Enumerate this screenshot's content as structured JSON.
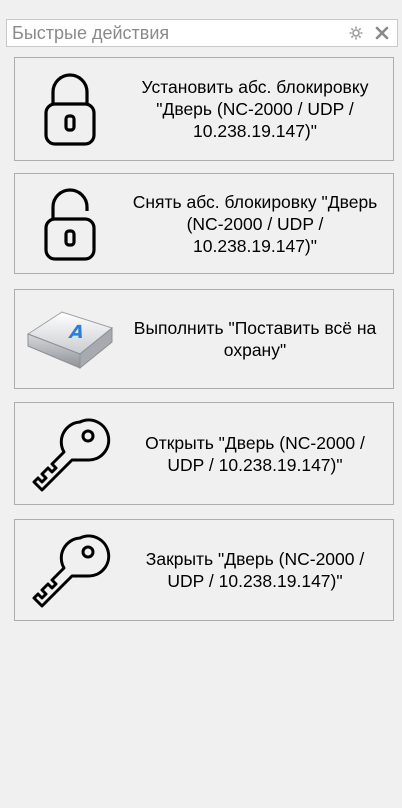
{
  "panel": {
    "title": "Быстрые действия",
    "settings_icon": "gear-icon",
    "close_icon": "close-icon"
  },
  "actions": [
    {
      "icon": "lock-closed-icon",
      "label": "Установить абс. блокировку \"Дверь (NC-2000 / UDP / 10.238.19.147)\""
    },
    {
      "icon": "lock-open-icon",
      "label": "Снять абс. блокировку \"Дверь (NC-2000 / UDP / 10.238.19.147)\""
    },
    {
      "icon": "keyboard-key-icon",
      "label": "Выполнить \"Поставить всё на охрану\""
    },
    {
      "icon": "key-icon",
      "label": "Открыть \"Дверь (NC-2000 / UDP / 10.238.19.147)\""
    },
    {
      "icon": "key-icon",
      "label": "Закрыть \"Дверь (NC-2000 / UDP / 10.238.19.147)\""
    }
  ]
}
